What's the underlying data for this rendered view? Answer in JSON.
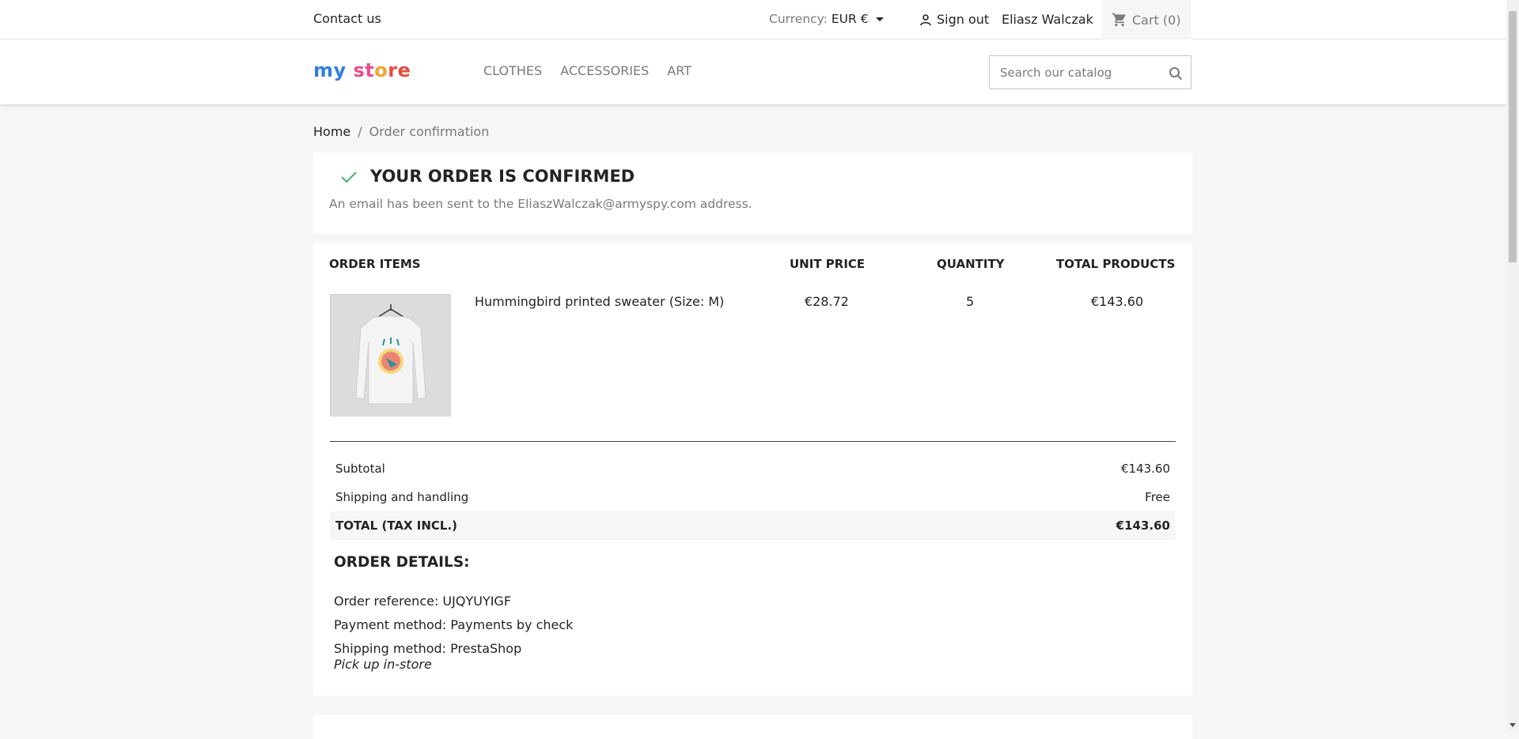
{
  "topnav": {
    "contact": "Contact us",
    "currency_label": "Currency:",
    "currency_value": "EUR €",
    "signout": "Sign out",
    "username": "Eliasz Walczak",
    "cart": "Cart",
    "cart_count": "(0)"
  },
  "header": {
    "logo": [
      "my",
      " ",
      "st",
      "o",
      "re"
    ],
    "menu": [
      "Clothes",
      "Accessories",
      "Art"
    ],
    "search_placeholder": "Search our catalog"
  },
  "breadcrumb": {
    "home": "Home",
    "separator": "/",
    "current": "Order confirmation"
  },
  "confirmation": {
    "title": "Your order is confirmed",
    "message": "An email has been sent to the EliaszWalczak@armyspy.com address."
  },
  "order": {
    "headers": {
      "items": "Order items",
      "unit_price": "Unit price",
      "quantity": "Quantity",
      "total": "Total products"
    },
    "items": [
      {
        "name": "Hummingbird printed sweater (Size: M)",
        "unit_price": "€28.72",
        "quantity": "5",
        "total": "€143.60"
      }
    ],
    "subtotal_label": "Subtotal",
    "subtotal": "€143.60",
    "shipping_label": "Shipping and handling",
    "shipping": "Free",
    "total_label": "TOTAL (TAX INCL.)",
    "total": "€143.60"
  },
  "details": {
    "title": "Order details:",
    "reference": "Order reference: UJQYUYIGF",
    "payment": "Payment method: Payments by check",
    "shipping": "Shipping method: PrestaShop",
    "shipping_note": "Pick up in-store"
  },
  "colors": {
    "check": "#4cbb6c",
    "text": "#232323",
    "muted": "#7a7a7a"
  }
}
